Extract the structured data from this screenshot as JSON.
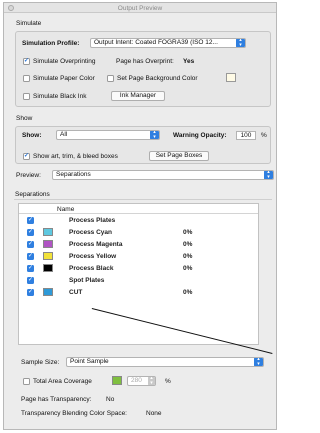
{
  "window": {
    "title": "Output Preview"
  },
  "simulate": {
    "heading": "Simulate",
    "profile_label": "Simulation Profile:",
    "profile_value": "Output Intent: Coated FOGRA39 (ISO 12...",
    "overprinting_label": "Simulate Overprinting",
    "overprinting_checked": true,
    "page_overprint_label": "Page has Overprint:",
    "page_overprint_value": "Yes",
    "paper_color_label": "Simulate Paper Color",
    "bg_color_label": "Set Page Background Color",
    "black_ink_label": "Simulate Black Ink",
    "ink_manager_label": "Ink Manager"
  },
  "show": {
    "heading": "Show",
    "show_label": "Show:",
    "show_value": "All",
    "warning_label": "Warning Opacity:",
    "warning_value": "100",
    "warning_unit": "%",
    "boxes_label": "Show art, trim, & bleed boxes",
    "boxes_checked": true,
    "set_boxes_label": "Set Page Boxes"
  },
  "preview": {
    "label": "Preview:",
    "value": "Separations"
  },
  "separations": {
    "heading": "Separations",
    "column_name": "Name",
    "rows": [
      {
        "name": "Process Plates",
        "pct": "",
        "color": "",
        "checked": true
      },
      {
        "name": "Process Cyan",
        "pct": "0%",
        "color": "#5ec8e0",
        "checked": true
      },
      {
        "name": "Process Magenta",
        "pct": "0%",
        "color": "#b054c4",
        "checked": true
      },
      {
        "name": "Process Yellow",
        "pct": "0%",
        "color": "#f2e23a",
        "checked": true
      },
      {
        "name": "Process Black",
        "pct": "0%",
        "color": "#000000",
        "checked": true
      },
      {
        "name": "Spot Plates",
        "pct": "",
        "color": "",
        "checked": true
      },
      {
        "name": "CUT",
        "pct": "0%",
        "color": "#2e9ad8",
        "checked": true
      }
    ]
  },
  "sample": {
    "label": "Sample Size:",
    "value": "Point Sample"
  },
  "coverage": {
    "label": "Total Area Coverage",
    "value": "280",
    "unit": "%",
    "swatch_color": "#7fbf3f"
  },
  "transparency": {
    "has_label": "Page has Transparency:",
    "has_value": "No",
    "blend_label": "Transparency Blending Color Space:",
    "blend_value": "None"
  }
}
